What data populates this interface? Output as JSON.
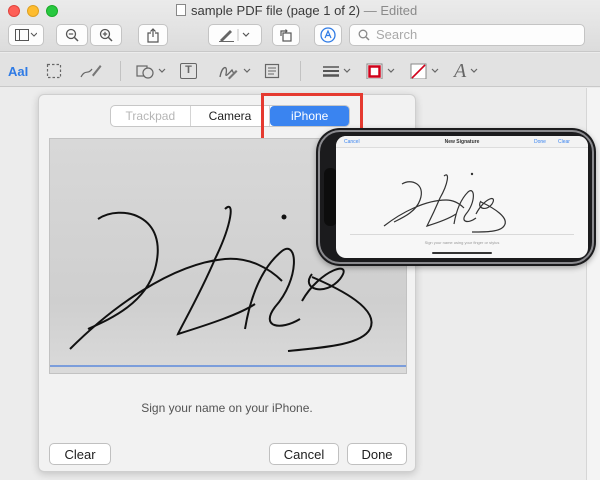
{
  "window": {
    "title": "sample PDF file (page 1 of 2)",
    "status": "— Edited"
  },
  "toolbar": {
    "search_placeholder": "Search",
    "icons": [
      "sidebar-icon",
      "zoom-out-icon",
      "zoom-in-icon",
      "share-icon",
      "pen-icon",
      "rotate-icon",
      "markup-icon"
    ]
  },
  "markup": {
    "text_selection_label": "AaI",
    "text_box_label": "T",
    "font_label": "A",
    "icons": [
      "text-selection-icon",
      "rect-selection-icon",
      "sketch-icon",
      "shapes-icon",
      "text-box-icon",
      "sign-icon",
      "note-icon",
      "line-style-icon",
      "border-color-icon",
      "fill-color-icon",
      "font-icon"
    ],
    "border_color": "#d0021b",
    "accent_color": "#2f7be5"
  },
  "signature_panel": {
    "tabs": [
      {
        "label": "Trackpad",
        "state": "disabled"
      },
      {
        "label": "Camera",
        "state": "normal"
      },
      {
        "label": "iPhone",
        "state": "selected"
      }
    ],
    "instruction": "Sign your name on your iPhone.",
    "clear_label": "Clear",
    "cancel_label": "Cancel",
    "done_label": "Done"
  },
  "phone": {
    "nav_cancel": "Cancel",
    "nav_title": "New Signature",
    "nav_done": "Done",
    "nav_clear": "Clear",
    "hint": "Sign your name using your finger or stylus"
  },
  "colors": {
    "selected_tab": "#3a84f0",
    "highlight": "#e53a30"
  }
}
